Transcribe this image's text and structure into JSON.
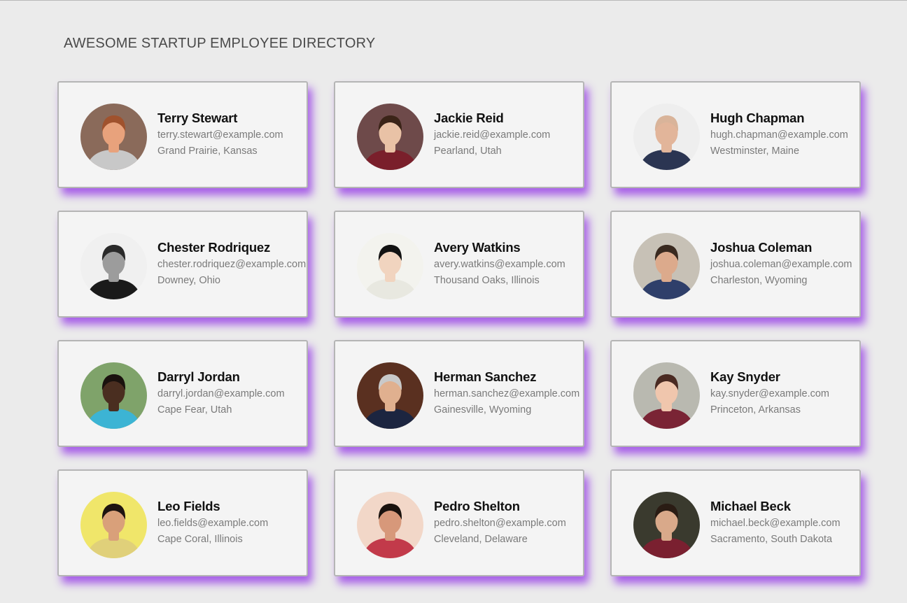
{
  "page": {
    "title": "AWESOME STARTUP EMPLOYEE DIRECTORY"
  },
  "theme": {
    "background": "#ebebeb",
    "card_background": "#f4f4f4",
    "card_border": "#b5b5b5",
    "shadow_accent": "#9b46e6",
    "name_color": "#111111",
    "detail_color": "#7a7a7a"
  },
  "employees": [
    {
      "name": "Terry Stewart",
      "email": "terry.stewart@example.com",
      "location": "Grand Prairie, Kansas",
      "photo": {
        "bg": "#8a6a5a",
        "skin": "#e8a27c",
        "hair": "#a0522d",
        "shirt": "#c8c8c8"
      }
    },
    {
      "name": "Jackie Reid",
      "email": "jackie.reid@example.com",
      "location": "Pearland, Utah",
      "photo": {
        "bg": "#6e4a4a",
        "skin": "#e9c2a6",
        "hair": "#3b2418",
        "shirt": "#7a1f2b"
      }
    },
    {
      "name": "Hugh Chapman",
      "email": "hugh.chapman@example.com",
      "location": "Westminster, Maine",
      "photo": {
        "bg": "#eeeeee",
        "skin": "#e2b59a",
        "hair": "#d9b49a",
        "shirt": "#2b3552"
      }
    },
    {
      "name": "Chester Rodriquez",
      "email": "chester.rodriquez@example.com",
      "location": "Downey, Ohio",
      "photo": {
        "bg": "#f0f0f0",
        "skin": "#9c9c9c",
        "hair": "#2a2a2a",
        "shirt": "#1a1a1a"
      }
    },
    {
      "name": "Avery Watkins",
      "email": "avery.watkins@example.com",
      "location": "Thousand Oaks, Illinois",
      "photo": {
        "bg": "#f3f3ee",
        "skin": "#f1d4bf",
        "hair": "#121212",
        "shirt": "#e8e8e0"
      }
    },
    {
      "name": "Joshua Coleman",
      "email": "joshua.coleman@example.com",
      "location": "Charleston, Wyoming",
      "photo": {
        "bg": "#c7c1b6",
        "skin": "#dcaa8c",
        "hair": "#3a2a20",
        "shirt": "#2f3f6a"
      }
    },
    {
      "name": "Darryl Jordan",
      "email": "darryl.jordan@example.com",
      "location": "Cape Fear, Utah",
      "photo": {
        "bg": "#7fa36a",
        "skin": "#4a2e20",
        "hair": "#1a120e",
        "shirt": "#3cb4d4"
      }
    },
    {
      "name": "Herman Sanchez",
      "email": "herman.sanchez@example.com",
      "location": "Gainesville, Wyoming",
      "photo": {
        "bg": "#5a3020",
        "skin": "#e0b08f",
        "hair": "#c9c9c9",
        "shirt": "#1c2540"
      }
    },
    {
      "name": "Kay Snyder",
      "email": "kay.snyder@example.com",
      "location": "Princeton, Arkansas",
      "photo": {
        "bg": "#b9b9b0",
        "skin": "#f0c6ad",
        "hair": "#4a2a22",
        "shirt": "#7a2435"
      }
    },
    {
      "name": "Leo Fields",
      "email": "leo.fields@example.com",
      "location": "Cape Coral, Illinois",
      "photo": {
        "bg": "#f0e66a",
        "skin": "#d9a07a",
        "hair": "#1e1410",
        "shirt": "#e0d07a"
      }
    },
    {
      "name": "Pedro Shelton",
      "email": "pedro.shelton@example.com",
      "location": "Cleveland, Delaware",
      "photo": {
        "bg": "#f2d7c8",
        "skin": "#d7987a",
        "hair": "#1a120e",
        "shirt": "#c23a4a"
      }
    },
    {
      "name": "Michael Beck",
      "email": "michael.beck@example.com",
      "location": "Sacramento, South Dakota",
      "photo": {
        "bg": "#3a3a2e",
        "skin": "#d9a98a",
        "hair": "#2a1c14",
        "shirt": "#7a2030"
      }
    }
  ]
}
